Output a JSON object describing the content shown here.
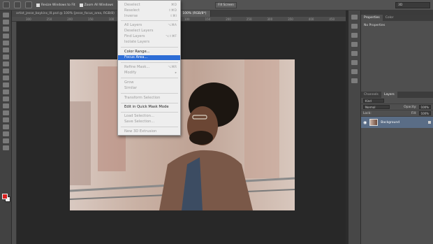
{
  "options_bar": {
    "resize_windows_label": "Resize Windows to Fit",
    "zoom_all_label": "Zoom All Windows",
    "fill_screen_label": "Fill Screen",
    "workspace_value": "3D"
  },
  "document_tabs": [
    {
      "label": "artist_jesse_boykins_III.psd @ 100% (jesse_focus_area, RGB/8)",
      "active": false
    },
    {
      "label": "...@ 100% (jesse_focus_area, ...",
      "active": false
    },
    {
      "label": "100% (RGB/8*)",
      "active": true
    }
  ],
  "ruler_labels": [
    "300",
    "250",
    "200",
    "150",
    "100",
    "50",
    "0",
    "50",
    "100",
    "150",
    "200",
    "250",
    "300",
    "350",
    "400",
    "450",
    "500",
    "550",
    "600"
  ],
  "select_menu": {
    "items": [
      {
        "label": "Deselect",
        "shortcut": "⌘D",
        "disabled": true
      },
      {
        "label": "Reselect",
        "shortcut": "⇧⌘D",
        "disabled": true
      },
      {
        "label": "Inverse",
        "shortcut": "⇧⌘I",
        "disabled": true
      },
      {
        "label": "All Layers",
        "shortcut": "⌥⌘A",
        "disabled": true
      },
      {
        "label": "Deselect Layers",
        "shortcut": "",
        "disabled": true
      },
      {
        "label": "Find Layers",
        "shortcut": "⌥⇧⌘F",
        "disabled": true
      },
      {
        "label": "Isolate Layers",
        "shortcut": "",
        "disabled": true
      },
      {
        "label": "Color Range...",
        "shortcut": "",
        "disabled": false
      },
      {
        "label": "Focus Area...",
        "shortcut": "",
        "disabled": false,
        "highlighted": true
      },
      {
        "label": "Refine Mask...",
        "shortcut": "⌥⌘R",
        "disabled": true
      },
      {
        "label": "Modify",
        "shortcut": "▸",
        "disabled": true
      },
      {
        "label": "Grow",
        "shortcut": "",
        "disabled": true
      },
      {
        "label": "Similar",
        "shortcut": "",
        "disabled": true
      },
      {
        "label": "Transform Selection",
        "shortcut": "",
        "disabled": true
      },
      {
        "label": "Edit in Quick Mask Mode",
        "shortcut": "",
        "disabled": false
      },
      {
        "label": "Load Selection...",
        "shortcut": "",
        "disabled": true
      },
      {
        "label": "Save Selection...",
        "shortcut": "",
        "disabled": true
      },
      {
        "label": "New 3D Extrusion",
        "shortcut": "",
        "disabled": true
      }
    ]
  },
  "properties_panel": {
    "tabs": [
      "Properties",
      "Color"
    ],
    "body_text": "No Properties"
  },
  "layers_panel": {
    "tabs": [
      "Channels",
      "Layers"
    ],
    "kind_filter": "Kind",
    "blend_mode": "Normal",
    "opacity_label": "Opacity:",
    "opacity_value": "100%",
    "lock_label": "Lock:",
    "fill_label": "Fill:",
    "fill_value": "100%",
    "layer_name": "Background"
  },
  "colors": {
    "foreground": "#d81e1e",
    "background": "#eeeeee",
    "menu_highlight": "#2d6dd6"
  }
}
